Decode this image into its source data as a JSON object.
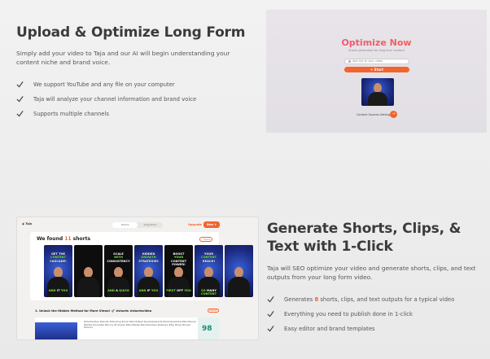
{
  "section1": {
    "title": "Upload & Optimize Long Form",
    "description": "Simply add your video to Taja and our AI will begin understanding your content niche and brand voice.",
    "features": [
      "We support YouTube and any file on your computer",
      "Taja will analyze your channel information and brand voice",
      "Supports multiple channels"
    ],
    "card": {
      "title": "Optimize Now",
      "subtitle": "Shorts generated for long form content",
      "input_placeholder": "Add link to your video",
      "start_label": "+ Start",
      "caption": "Content Sources Settings ...",
      "go_label": "→"
    }
  },
  "section2": {
    "title": "Generate Shorts, Clips, & Text with 1-Click",
    "description": "Taja will SEO optimize your video and generate shorts, clips, and text outputs from your long form video.",
    "features": [
      {
        "pre": "Generates ",
        "num": "8",
        "post": " shorts, clips, and text outputs for a typical video"
      },
      {
        "pre": "Everything you need to publish done in 1-click",
        "num": "",
        "post": ""
      },
      {
        "pre": "Easy editor and brand templates",
        "num": "",
        "post": ""
      }
    ],
    "card": {
      "logo": "◉ Taja",
      "tabs": [
        "Shorts",
        "Long Form"
      ],
      "upgrade_label": "Upgrade",
      "new_label": "New +",
      "found_prefix": "We found ",
      "found_count": "11",
      "found_suffix": " shorts",
      "share_label": "• Share",
      "thumbs": [
        {
          "top": "GET THE",
          "topg": "CONTENT",
          "top2": "CASCADE!",
          "bot": "AND",
          "botw": " IT ",
          "bot2": "YOU",
          "dark": false
        },
        {
          "top": "",
          "topg": "",
          "top2": "",
          "bot": "",
          "botw": "",
          "bot2": "",
          "dark": true
        },
        {
          "top": "SCALE",
          "topg": "WITH",
          "top2": "CONSISTENCY",
          "bot": "AND",
          "botw": " A ",
          "bot2": "QUICK",
          "dark": true
        },
        {
          "top": "HIDDEN",
          "topg": "GROWTH",
          "top2": "STRATEGIES",
          "bot": "AND",
          "botw": " IF ",
          "bot2": "YOU",
          "dark": false
        },
        {
          "top": "BOOST",
          "topg": "YOUR",
          "top2": "CONTENT POWER!",
          "bot": "FIRST",
          "botw": " OFF ",
          "bot2": "YOU",
          "dark": true
        },
        {
          "top": "YOUR",
          "topg": "CONTENT",
          "top2": "REACH!",
          "bot": "SO",
          "botw": " MANY ",
          "bot2": "CONTENT",
          "dark": false
        },
        {
          "top": "",
          "topg": "",
          "top2": "",
          "bot": "",
          "botw": "",
          "bot2": "",
          "dark": false
        }
      ],
      "row_title": "1. Unlock the Hidden Method for More Views! 🚀 #shorts #shortsvideo",
      "row_button": "Publish",
      "row_text": "#shortsvideo #shorts #trending #viral #shortsfeed #youtubeshorts #shortsyoutube #shortsviral #tiktok #youtube #funny #comedy #shortsbeta #shortsvideos #explore #fyp #love #music #dance",
      "score": "98"
    }
  }
}
